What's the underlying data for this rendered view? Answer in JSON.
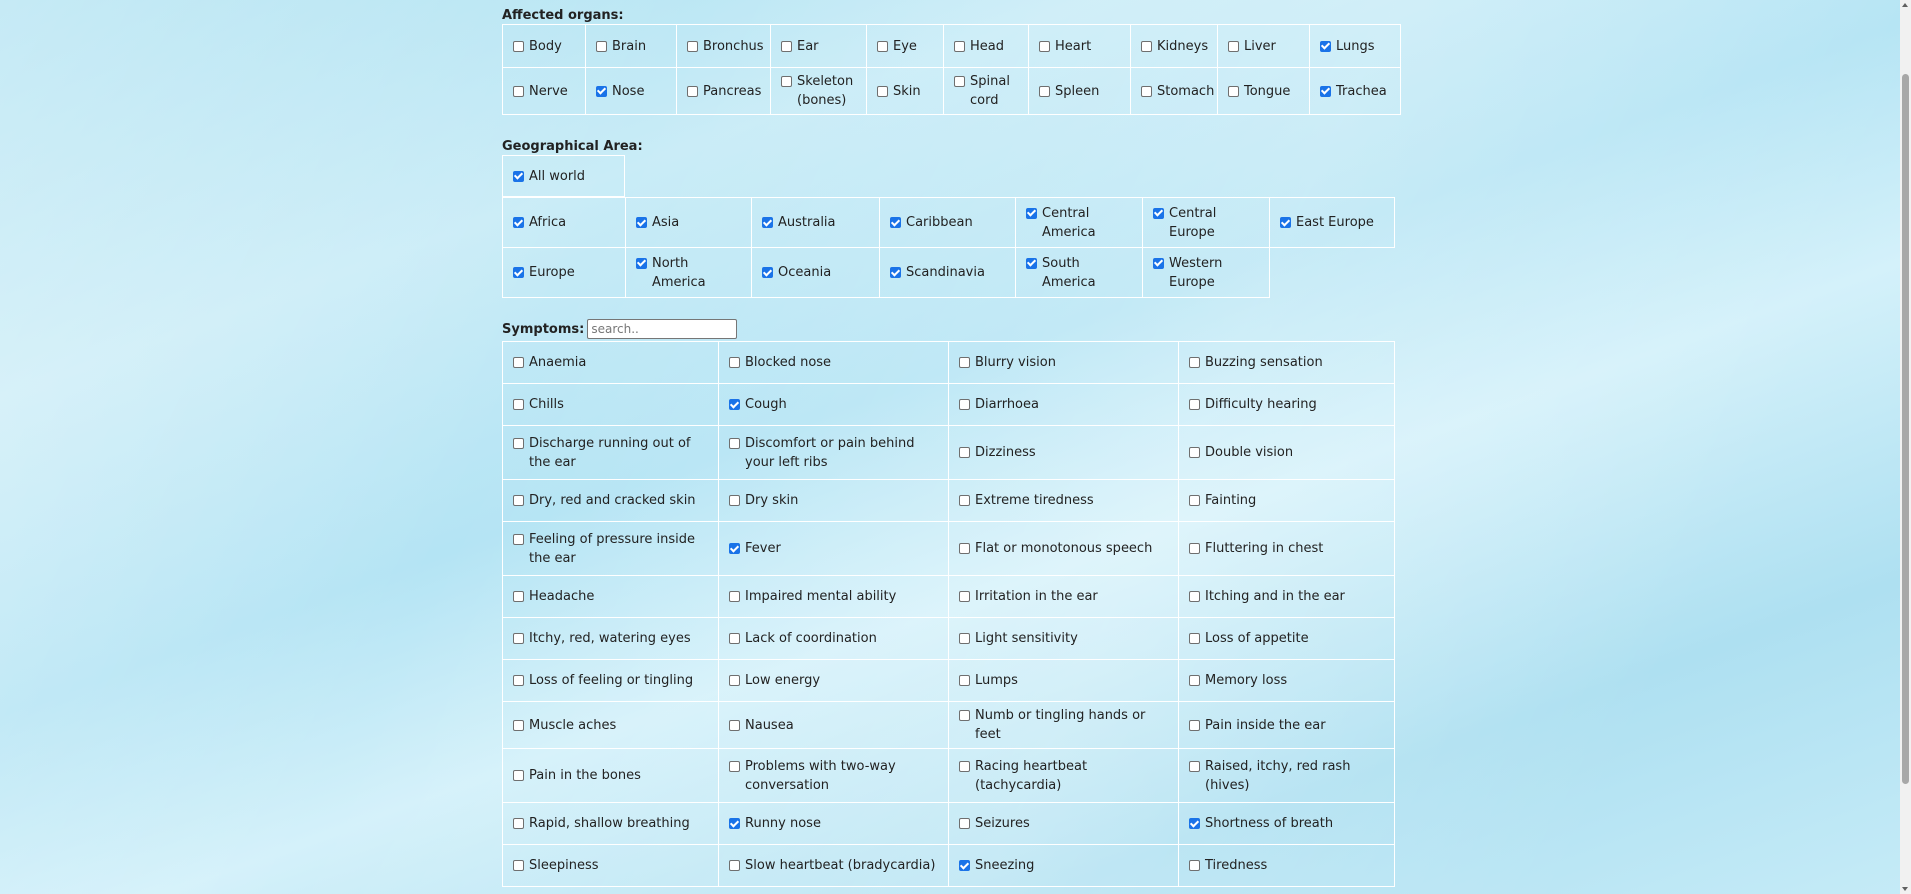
{
  "organs": {
    "title": "Affected organs:",
    "rows": [
      [
        {
          "label": "Body",
          "checked": false
        },
        {
          "label": "Brain",
          "checked": false
        },
        {
          "label": "Bronchus",
          "checked": false
        },
        {
          "label": "Ear",
          "checked": false
        },
        {
          "label": "Eye",
          "checked": false
        },
        {
          "label": "Head",
          "checked": false
        },
        {
          "label": "Heart",
          "checked": false
        },
        {
          "label": "Kidneys",
          "checked": false
        },
        {
          "label": "Liver",
          "checked": false
        },
        {
          "label": "Lungs",
          "checked": true
        }
      ],
      [
        {
          "label": "Nerve",
          "checked": false
        },
        {
          "label": "Nose",
          "checked": true
        },
        {
          "label": "Pancreas",
          "checked": false
        },
        {
          "label": "Skeleton (bones)",
          "checked": false
        },
        {
          "label": "Skin",
          "checked": false
        },
        {
          "label": "Spinal cord",
          "checked": false
        },
        {
          "label": "Spleen",
          "checked": false
        },
        {
          "label": "Stomach",
          "checked": false
        },
        {
          "label": "Tongue",
          "checked": false
        },
        {
          "label": "Trachea",
          "checked": true
        }
      ]
    ]
  },
  "geo": {
    "title": "Geographical Area:",
    "all": {
      "label": "All world",
      "checked": true
    },
    "rows": [
      [
        {
          "label": "Africa",
          "checked": true
        },
        {
          "label": "Asia",
          "checked": true
        },
        {
          "label": "Australia",
          "checked": true
        },
        {
          "label": "Caribbean",
          "checked": true
        },
        {
          "label": "Central America",
          "checked": true
        },
        {
          "label": "Central Europe",
          "checked": true
        },
        {
          "label": "East Europe",
          "checked": true
        }
      ],
      [
        {
          "label": "Europe",
          "checked": true
        },
        {
          "label": "North America",
          "checked": true
        },
        {
          "label": "Oceania",
          "checked": true
        },
        {
          "label": "Scandinavia",
          "checked": true
        },
        {
          "label": "South America",
          "checked": true
        },
        {
          "label": "Western Europe",
          "checked": true
        }
      ]
    ]
  },
  "symptoms": {
    "title": "Symptoms:",
    "search_placeholder": "search..",
    "rows": [
      [
        {
          "label": "Anaemia",
          "checked": false
        },
        {
          "label": "Blocked nose",
          "checked": false
        },
        {
          "label": "Blurry vision",
          "checked": false
        },
        {
          "label": "Buzzing sensation",
          "checked": false
        }
      ],
      [
        {
          "label": "Chills",
          "checked": false
        },
        {
          "label": "Cough",
          "checked": true
        },
        {
          "label": "Diarrhoea",
          "checked": false
        },
        {
          "label": "Difficulty hearing",
          "checked": false
        }
      ],
      [
        {
          "label": "Discharge running out of the ear",
          "checked": false
        },
        {
          "label": "Discomfort or pain behind your left ribs",
          "checked": false
        },
        {
          "label": "Dizziness",
          "checked": false
        },
        {
          "label": "Double vision",
          "checked": false
        }
      ],
      [
        {
          "label": "Dry, red and cracked skin",
          "checked": false
        },
        {
          "label": "Dry skin",
          "checked": false
        },
        {
          "label": "Extreme tiredness",
          "checked": false
        },
        {
          "label": "Fainting",
          "checked": false
        }
      ],
      [
        {
          "label": "Feeling of pressure inside the ear",
          "checked": false
        },
        {
          "label": "Fever",
          "checked": true
        },
        {
          "label": "Flat or monotonous speech",
          "checked": false
        },
        {
          "label": "Fluttering in chest",
          "checked": false
        }
      ],
      [
        {
          "label": "Headache",
          "checked": false
        },
        {
          "label": "Impaired mental ability",
          "checked": false
        },
        {
          "label": "Irritation in the ear",
          "checked": false
        },
        {
          "label": "Itching and in the ear",
          "checked": false
        }
      ],
      [
        {
          "label": "Itchy, red, watering eyes",
          "checked": false
        },
        {
          "label": "Lack of coordination",
          "checked": false
        },
        {
          "label": "Light sensitivity",
          "checked": false
        },
        {
          "label": "Loss of appetite",
          "checked": false
        }
      ],
      [
        {
          "label": "Loss of feeling or tingling",
          "checked": false
        },
        {
          "label": "Low energy",
          "checked": false
        },
        {
          "label": "Lumps",
          "checked": false
        },
        {
          "label": "Memory loss",
          "checked": false
        }
      ],
      [
        {
          "label": "Muscle aches",
          "checked": false
        },
        {
          "label": "Nausea",
          "checked": false
        },
        {
          "label": "Numb or tingling hands or feet",
          "checked": false
        },
        {
          "label": "Pain inside the ear",
          "checked": false
        }
      ],
      [
        {
          "label": "Pain in the bones",
          "checked": false
        },
        {
          "label": "Problems with two-way conversation",
          "checked": false
        },
        {
          "label": "Racing heartbeat (tachycardia)",
          "checked": false
        },
        {
          "label": "Raised, itchy, red rash (hives)",
          "checked": false
        }
      ],
      [
        {
          "label": "Rapid, shallow breathing",
          "checked": false
        },
        {
          "label": "Runny nose",
          "checked": true
        },
        {
          "label": "Seizures",
          "checked": false
        },
        {
          "label": "Shortness of breath",
          "checked": true
        }
      ],
      [
        {
          "label": "Sleepiness",
          "checked": false
        },
        {
          "label": "Slow heartbeat (bradycardia)",
          "checked": false
        },
        {
          "label": "Sneezing",
          "checked": true
        },
        {
          "label": "Tiredness",
          "checked": false
        }
      ]
    ]
  }
}
